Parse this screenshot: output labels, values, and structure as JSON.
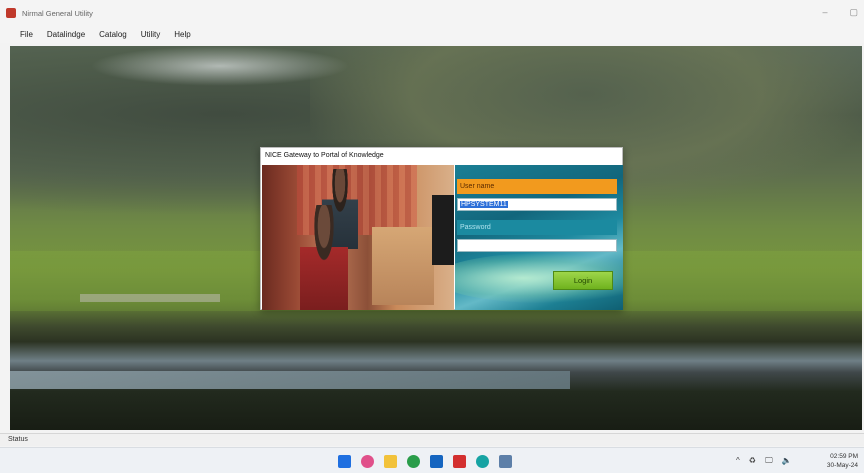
{
  "window": {
    "title": "Nirmal General Utility",
    "controls": [
      "–",
      "▢"
    ]
  },
  "menu": {
    "items": [
      "File",
      "Datalindge",
      "Catalog",
      "Utility",
      "Help"
    ]
  },
  "dialog": {
    "title": "NICE Gateway to Portal of Knowledge",
    "username_label": "User name",
    "username_value": "HPSYSTEM11",
    "password_label": "Password",
    "login_button": "Login"
  },
  "statusbar": {
    "text": "Status"
  },
  "taskbar": {
    "icons": [
      "windows-start-icon",
      "copilot-icon",
      "file-explorer-icon",
      "chrome-icon",
      "outlook-icon",
      "acrobat-icon",
      "edge-icon",
      "notepad-icon"
    ],
    "icon_colors": [
      "#1f6fe0",
      "#e0508a",
      "#f2c23a",
      "#2a9d4a",
      "#1565c0",
      "#d32f2f",
      "#16a3a3",
      "#5d7fa8"
    ],
    "tray": [
      "^",
      "♻",
      "🖵",
      "🔈"
    ],
    "time": "02:59 PM",
    "date": "30-May-24"
  }
}
